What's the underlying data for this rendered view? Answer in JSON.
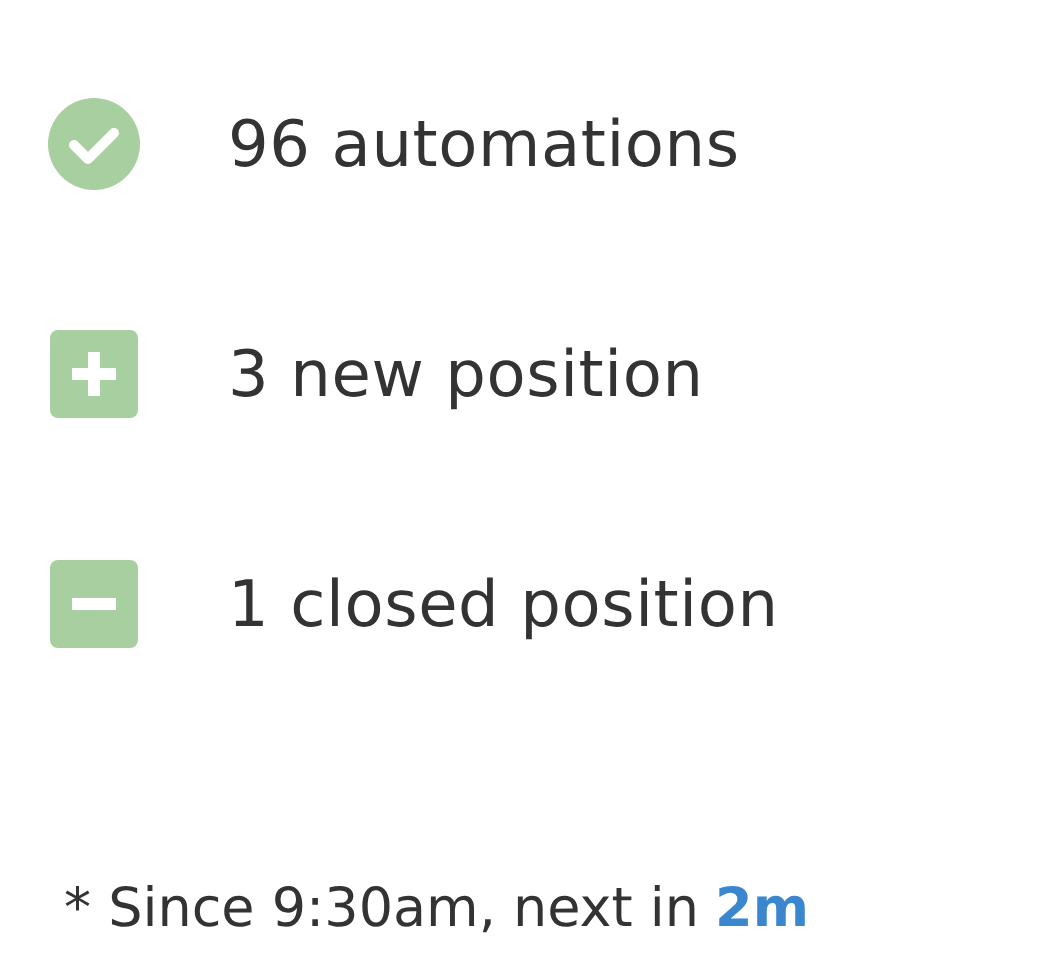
{
  "items": [
    {
      "kind": "check",
      "text": "96 automations"
    },
    {
      "kind": "plus",
      "text": "3 new position"
    },
    {
      "kind": "minus",
      "text": "1 closed position"
    }
  ],
  "footer": {
    "text": "* Since 9:30am, next in",
    "link": "2m"
  }
}
